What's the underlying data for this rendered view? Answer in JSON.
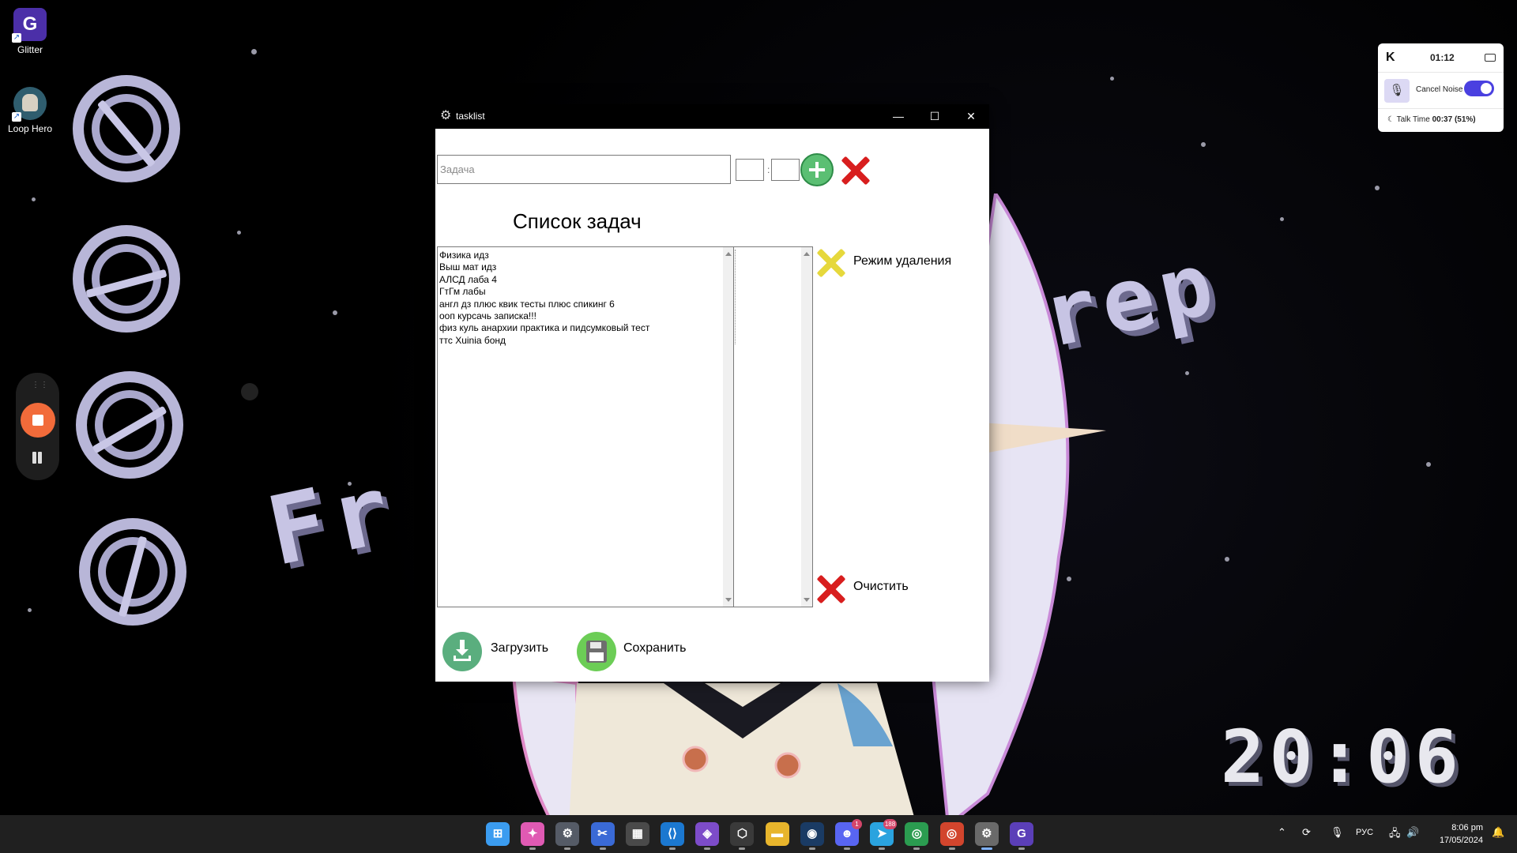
{
  "desktop": {
    "icons": [
      {
        "label": "Glitter",
        "icon": "glitter-app-icon"
      },
      {
        "label": "Loop Hero",
        "icon": "loop-hero-app-icon"
      }
    ],
    "wallpaper_text_left": "Fr",
    "wallpaper_text_right": "rep",
    "wallpaper_clock": "20:06"
  },
  "krisp": {
    "logo": "K",
    "timer": "01:12",
    "noise_label": "Cancel Noise",
    "noise_enabled": true,
    "talk_label": "Talk Time",
    "talk_value": "00:37 (51%)"
  },
  "window": {
    "title": "tasklist",
    "task_placeholder": "Задача",
    "time_separator": ":",
    "list_title": "Список задач",
    "tasks": [
      "Физика идз",
      "Выш мат идз",
      "АЛСД лаба 4",
      "ГтГм лабы",
      "англ дз плюс квик тесты плюс спикинг 6",
      "ооп курсачь записка!!!",
      "физ куль анархии практика и пидсумковый тест",
      "ттс Xuinia бонд"
    ],
    "delete_mode_label": "Режим удаления",
    "clear_label": "Очистить",
    "load_label": "Загрузить",
    "save_label": "Сохранить"
  },
  "taskbar": {
    "apps": [
      {
        "name": "start",
        "glyph": "⊞",
        "color": "#3b9cf0"
      },
      {
        "name": "copilot",
        "glyph": "✦",
        "color": "#e05ab3"
      },
      {
        "name": "settings-like",
        "glyph": "⚙",
        "color": "#555b66"
      },
      {
        "name": "snipping",
        "glyph": "✂",
        "color": "#3a6ad6"
      },
      {
        "name": "calculator",
        "glyph": "▦",
        "color": "#4a4a4a"
      },
      {
        "name": "vscode",
        "glyph": "⟨⟩",
        "color": "#1b78d0"
      },
      {
        "name": "visual-studio",
        "glyph": "◈",
        "color": "#7d4cc9"
      },
      {
        "name": "unity",
        "glyph": "⬡",
        "color": "#3a3a3a"
      },
      {
        "name": "file-explorer",
        "glyph": "▬",
        "color": "#e8b52c"
      },
      {
        "name": "steam",
        "glyph": "◉",
        "color": "#1a3b64"
      },
      {
        "name": "discord",
        "glyph": "☻",
        "color": "#5865f2"
      },
      {
        "name": "telegram",
        "glyph": "➤",
        "color": "#2aa3df"
      },
      {
        "name": "chrome",
        "glyph": "◎",
        "color": "#2b9c50"
      },
      {
        "name": "chrome-2",
        "glyph": "◎",
        "color": "#d2452d"
      },
      {
        "name": "tasklist",
        "glyph": "⚙",
        "color": "#6a6a6a"
      },
      {
        "name": "glitter",
        "glyph": "G",
        "color": "#5b3fb8"
      }
    ],
    "badges": {
      "discord": "1",
      "telegram": "188"
    },
    "language": "РУС",
    "time": "8:06 pm",
    "date": "17/05/2024"
  }
}
